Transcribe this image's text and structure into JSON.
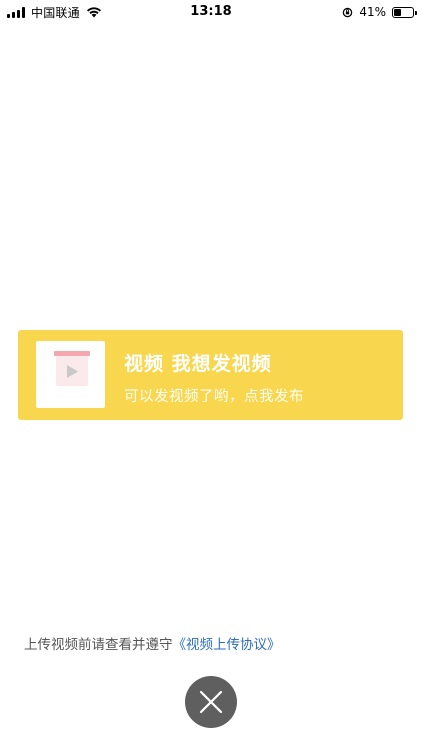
{
  "status_bar": {
    "carrier": "中国联通",
    "time": "13:18",
    "battery_percent": "41%",
    "battery_level": 0.41
  },
  "upload_card": {
    "title": "视频 我想发视频",
    "subtitle": "可以发视频了哟，点我发布",
    "background_color": "#f8d74e",
    "icon": "video-play-icon"
  },
  "agreement": {
    "prefix": "上传视频前请查看并遵守",
    "link_text": "《视频上传协议》",
    "link_color": "#2e6fbd"
  },
  "close_button": {
    "icon": "close-icon",
    "background_color": "#5f5f5f"
  }
}
